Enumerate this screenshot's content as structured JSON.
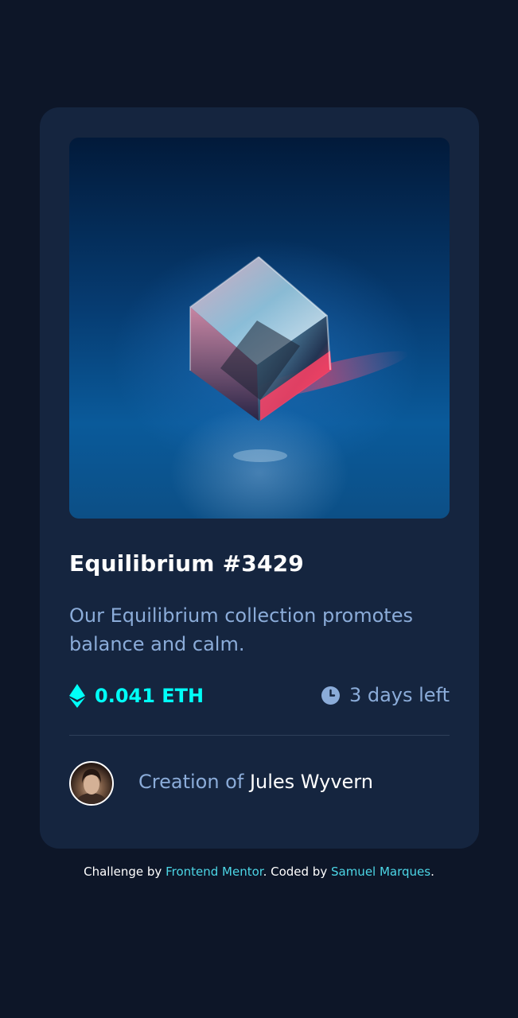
{
  "card": {
    "title": "Equilibrium #3429",
    "description": "Our Equilibrium collection promotes balance and calm.",
    "image_alt": "Equilibrium cube artwork",
    "price": "0.041 ETH",
    "time_left": "3 days left",
    "creation_prefix": "Creation of",
    "creator_name": "Jules Wyvern"
  },
  "icons": {
    "eth": "ethereum-icon",
    "clock": "clock-icon"
  },
  "colors": {
    "page_bg": "#0d1628",
    "card_bg": "#15253f",
    "accent_cyan": "#00fff8",
    "soft_blue": "#8bacd9",
    "white": "#ffffff",
    "divider": "#2e405a"
  },
  "footer": {
    "prefix": "Challenge by",
    "challenge_link": "Frontend Mentor",
    "middle": ". Coded by",
    "author_link": "Samuel Marques",
    "suffix": "."
  }
}
